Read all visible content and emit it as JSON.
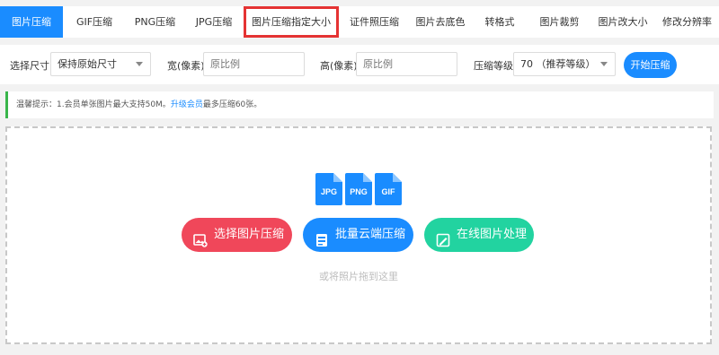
{
  "tabs": [
    {
      "label": "图片压缩",
      "active": true
    },
    {
      "label": "GIF压缩"
    },
    {
      "label": "PNG压缩"
    },
    {
      "label": "JPG压缩"
    },
    {
      "label": "图片压缩指定大小",
      "highlighted": true
    },
    {
      "label": "证件照压缩"
    },
    {
      "label": "图片去底色"
    },
    {
      "label": "转格式"
    },
    {
      "label": "图片裁剪"
    },
    {
      "label": "图片改大小"
    },
    {
      "label": "修改分辨率"
    }
  ],
  "toolbar": {
    "size_label": "选择尺寸",
    "size_value": "保持原始尺寸",
    "width_label": "宽(像素)",
    "width_placeholder": "原比例",
    "height_label": "高(像素)",
    "height_placeholder": "原比例",
    "level_label": "压缩等级",
    "level_value": "70 （推荐等级）",
    "start_label": "开始压缩"
  },
  "tip": {
    "prefix": "温馨提示：1.会员单张图片最大支持50M。",
    "link": "升级会员",
    "suffix": "最多压缩60张。"
  },
  "dropzone": {
    "filetypes": [
      "JPG",
      "PNG",
      "GIF"
    ],
    "select_label": "选择图片压缩",
    "batch_label": "批量云端压缩",
    "online_label": "在线图片处理",
    "hint": "或将照片拖到这里"
  },
  "colors": {
    "primary": "#1a8cff",
    "red": "#f0475a",
    "green": "#22d3a0",
    "highlight": "#e53333"
  }
}
